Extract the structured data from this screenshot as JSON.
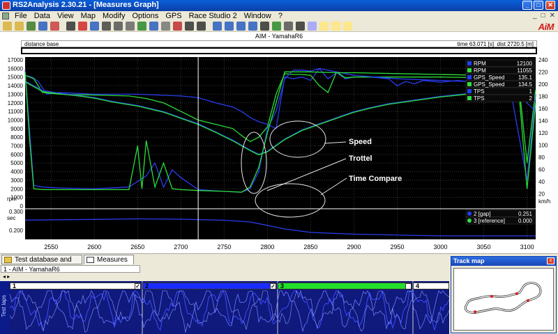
{
  "window": {
    "title": "RS2Analysis 2.30.21 - [Measures Graph]",
    "minimize": "_",
    "maximize": "□",
    "close": "✕"
  },
  "menu": {
    "items": [
      "File",
      "Data",
      "View",
      "Map",
      "Modify",
      "Options",
      "GPS",
      "Race Studio 2",
      "Window",
      "?"
    ],
    "right_controls": [
      "_",
      "□",
      "✕"
    ]
  },
  "toolbar": {
    "logo": "AiM"
  },
  "graph": {
    "title": "AIM - YamahaR6",
    "distance_base_label": "distance base",
    "time_readout": "time 63.071 [s]",
    "dist_readout": "dist 2720.5 [m]"
  },
  "chart_data": {
    "type": "line",
    "x": {
      "min": 2520,
      "max": 3110,
      "ticks": [
        2550,
        2600,
        2650,
        2700,
        2750,
        2800,
        2850,
        2900,
        2950,
        3000,
        3050,
        3100
      ]
    },
    "y_left": {
      "label": "rpm",
      "min": 0,
      "max": 17000,
      "ticks": [
        0,
        1000,
        2000,
        3000,
        4000,
        5000,
        6000,
        7000,
        8000,
        9000,
        10000,
        11000,
        12000,
        13000,
        14000,
        15000,
        16000,
        17000
      ]
    },
    "y_right": {
      "label": "km/h",
      "min": 0,
      "max": 240,
      "ticks": [
        20,
        40,
        60,
        80,
        100,
        120,
        140,
        160,
        180,
        200,
        220,
        240
      ]
    },
    "y_lower": {
      "label": "sec",
      "ticks": [
        "0.300",
        "0.200"
      ]
    },
    "legend_upper": [
      {
        "name": "RPM",
        "value": "12100",
        "color": "#2040ff"
      },
      {
        "name": "RPM",
        "value": "11055",
        "color": "#30e040"
      },
      {
        "name": "GPS_Speed",
        "value": "135.1",
        "color": "#2040ff"
      },
      {
        "name": "GPS_Speed",
        "value": "134.5",
        "color": "#30e040"
      },
      {
        "name": "TPS",
        "value": "1",
        "color": "#2040ff"
      },
      {
        "name": "TPS",
        "value": "2",
        "color": "#30e040"
      }
    ],
    "legend_lower": [
      {
        "name": "2 [gap]",
        "value": "0.251",
        "color": "#2040ff"
      },
      {
        "name": "3 [reference]",
        "value": "0.000",
        "color": "#30e040"
      }
    ],
    "annotations": [
      {
        "text": "Speed"
      },
      {
        "text": "Trottel"
      },
      {
        "text": "Time Compare"
      }
    ],
    "series": [
      {
        "name": "RPM",
        "color": "#2a3cf0",
        "x": [
          2520,
          2528,
          2535,
          2545,
          2560,
          2600,
          2650,
          2700,
          2720,
          2740,
          2760,
          2770,
          2780,
          2790,
          2800,
          2810,
          2820,
          2830,
          2840,
          2850,
          2860,
          2870,
          2880,
          2890,
          2900,
          2920,
          2940,
          2950,
          2960,
          2970,
          2980,
          3000,
          3020,
          3050,
          3080,
          3100,
          3110
        ],
        "y": [
          15200,
          15000,
          14500,
          13000,
          13200,
          13000,
          13000,
          12800,
          12600,
          12000,
          11500,
          11000,
          10300,
          9800,
          9500,
          9000,
          15000,
          14800,
          15000,
          14600,
          16000,
          14800,
          15500,
          14800,
          15000,
          15000,
          14800,
          14000,
          14500,
          14200,
          14600,
          14400,
          14600,
          14300,
          14000,
          3000,
          13000
        ]
      },
      {
        "name": "RPM",
        "color": "#2adf3a",
        "x": [
          2520,
          2530,
          2540,
          2560,
          2600,
          2640,
          2660,
          2680,
          2700,
          2720,
          2740,
          2760,
          2770,
          2780,
          2790,
          2800,
          2810,
          2820,
          2830,
          2840,
          2850,
          2860,
          2870,
          2880,
          2890,
          2900,
          2950,
          3000,
          3050,
          3090,
          3100,
          3110
        ],
        "y": [
          15200,
          14800,
          13200,
          13000,
          12900,
          12800,
          12500,
          12000,
          11000,
          10000,
          9500,
          9000,
          8200,
          7500,
          8000,
          9200,
          13000,
          15400,
          15300,
          15300,
          15200,
          14000,
          13200,
          15600,
          14900,
          15000,
          15000,
          15000,
          14900,
          14800,
          5000,
          13500
        ]
      },
      {
        "name": "GPS_Speed",
        "color": "#2a3cf0",
        "x": [
          2520,
          2540,
          2560,
          2580,
          2600,
          2620,
          2650,
          2680,
          2700,
          2720,
          2740,
          2760,
          2780,
          2790,
          2800,
          2810,
          2820,
          2840,
          2860,
          2880,
          2900,
          2920,
          2940,
          2960,
          2980,
          3000,
          3020,
          3040,
          3060,
          3080,
          3100
        ],
        "y": [
          205,
          190,
          185,
          182,
          178,
          172,
          165,
          155,
          145,
          135,
          122,
          108,
          92,
          85,
          90,
          100,
          110,
          125,
          135,
          145,
          155,
          162,
          168,
          172,
          176,
          180,
          183,
          186,
          189,
          190,
          188
        ]
      },
      {
        "name": "GPS_Speed",
        "color": "#2adf3a",
        "x": [
          2520,
          2540,
          2560,
          2580,
          2600,
          2620,
          2650,
          2680,
          2700,
          2720,
          2740,
          2760,
          2780,
          2790,
          2800,
          2810,
          2820,
          2840,
          2860,
          2880,
          2900,
          2920,
          2940,
          2960,
          2980,
          3000,
          3020,
          3040,
          3060,
          3080,
          3100
        ],
        "y": [
          204,
          188,
          184,
          181,
          177,
          171,
          164,
          154,
          144,
          134,
          121,
          107,
          91,
          84,
          89,
          99,
          109,
          124,
          134,
          144,
          154,
          161,
          167,
          171,
          175,
          179,
          182,
          185,
          188,
          189,
          187
        ]
      },
      {
        "name": "TPS",
        "color": "#2a3cf0",
        "x": [
          2520,
          2525,
          2530,
          2540,
          2560,
          2600,
          2640,
          2660,
          2670,
          2680,
          2690,
          2700,
          2720,
          2750,
          2770,
          2780,
          2790,
          2800,
          2810,
          2820,
          2830,
          2840,
          2850,
          2860,
          2880,
          2900,
          2950,
          3000,
          3050,
          3080,
          3090,
          3100,
          3110
        ],
        "y": [
          15800,
          9000,
          2400,
          2200,
          2100,
          2000,
          2200,
          3500,
          5000,
          2200,
          4200,
          3300,
          1900,
          1700,
          1600,
          2000,
          4000,
          9000,
          11000,
          14800,
          15800,
          15800,
          15700,
          16000,
          15600,
          15200,
          14800,
          14600,
          14400,
          14200,
          15000,
          12000,
          11000
        ]
      },
      {
        "name": "TPS",
        "color": "#2adf3a",
        "x": [
          2520,
          2525,
          2530,
          2540,
          2560,
          2600,
          2640,
          2650,
          2655,
          2660,
          2670,
          2680,
          2690,
          2700,
          2720,
          2750,
          2770,
          2780,
          2790,
          2800,
          2810,
          2820,
          2830,
          2850,
          2880,
          2900,
          2950,
          3000,
          3050,
          3080,
          3090,
          3100,
          3110
        ],
        "y": [
          15600,
          8000,
          2000,
          1900,
          1900,
          1900,
          1900,
          7000,
          2000,
          7600,
          2200,
          5000,
          2000,
          1900,
          1800,
          1700,
          1600,
          2200,
          4500,
          8500,
          12000,
          15600,
          15600,
          15600,
          15500,
          15500,
          15400,
          15300,
          15200,
          15000,
          14000,
          2000,
          12000
        ]
      }
    ],
    "lower_series": [
      {
        "name": "2 [gap]",
        "color": "#2a3cf0",
        "x": [
          2520,
          2600,
          2650,
          2700,
          2750,
          2780,
          2800,
          2820,
          2850,
          2900,
          3000,
          3110
        ],
        "y": [
          0.251,
          0.255,
          0.258,
          0.256,
          0.25,
          0.24,
          0.22,
          0.2,
          0.18,
          0.17,
          0.16,
          0.16
        ]
      }
    ]
  },
  "tabs": [
    {
      "label": "Test database and Lap manager"
    },
    {
      "label": "Measures Graph"
    }
  ],
  "laps": {
    "session_label": "1 - AIM - YamahaR6",
    "side_label": "Test laps",
    "nav_arrows": "◂ ▸",
    "lap_numbers": [
      "1",
      "2",
      "3",
      "4"
    ],
    "lap_colors": [
      "#ffffff",
      "#1a2cff",
      "#22e02a",
      "#ffffff"
    ],
    "checked": [
      false,
      true,
      true,
      false
    ]
  },
  "trackmap": {
    "title": "Track map",
    "close": "x"
  }
}
